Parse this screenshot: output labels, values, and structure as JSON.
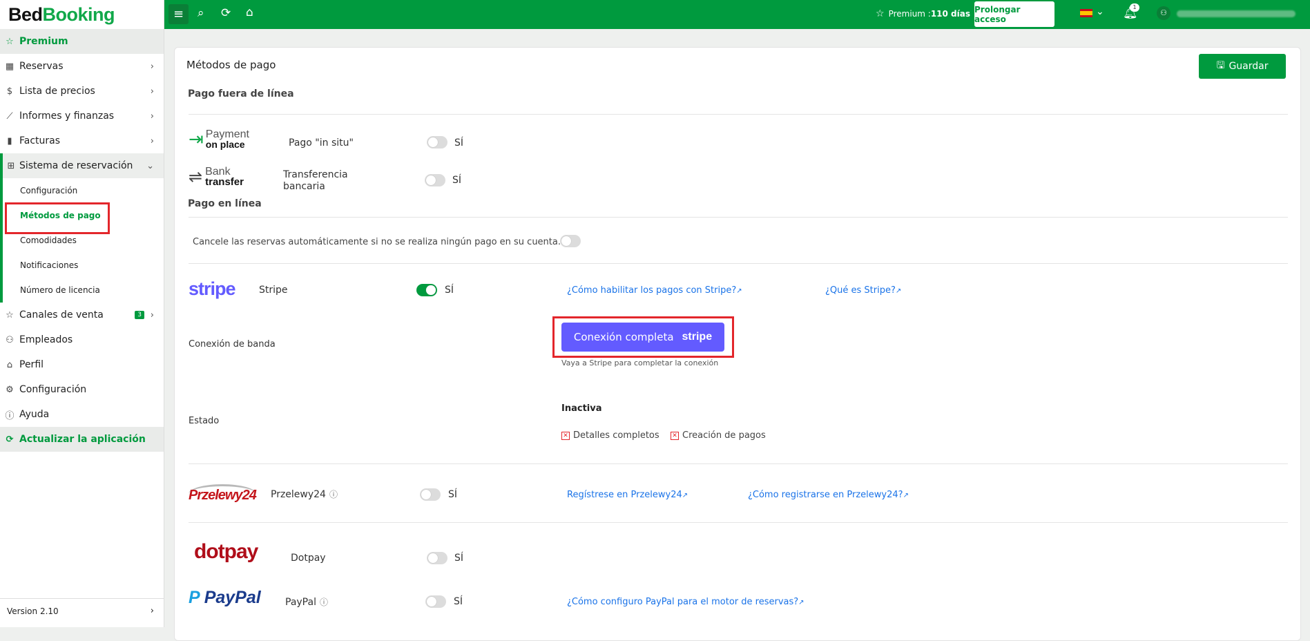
{
  "app": {
    "logo_part1": "Bed",
    "logo_part2": "Booking",
    "version": "Version 2.10"
  },
  "topbar": {
    "premium_label": "Premium : ",
    "premium_days": "110 días",
    "extend_button": "Prolongar acceso",
    "notification_count": "1",
    "language": "ES"
  },
  "sidebar": {
    "premium": "Premium",
    "items": [
      {
        "label": "Reservas",
        "icon": "calendar-icon"
      },
      {
        "label": "Lista de precios",
        "icon": "dollar-icon"
      },
      {
        "label": "Informes y finanzas",
        "icon": "chart-icon"
      },
      {
        "label": "Facturas",
        "icon": "invoice-icon"
      },
      {
        "label": "Sistema de reservación",
        "icon": "grid-icon"
      }
    ],
    "sub_items": [
      "Configuración",
      "Métodos de pago",
      "Comodidades",
      "Notificaciones",
      "Número de licencia"
    ],
    "items2": [
      {
        "label": "Canales de venta",
        "icon": "star-icon",
        "badge": "3"
      },
      {
        "label": "Empleados",
        "icon": "user-plus-icon"
      },
      {
        "label": "Perfil",
        "icon": "building-icon"
      },
      {
        "label": "Configuración",
        "icon": "gear-icon"
      },
      {
        "label": "Ayuda",
        "icon": "info-icon"
      }
    ],
    "update": "Actualizar la aplicación"
  },
  "page": {
    "title": "Métodos de pago",
    "save_button": "Guardar",
    "offline_section": "Pago fuera de línea",
    "online_section": "Pago en línea",
    "auto_cancel": "Cancele las reservas automáticamente si no se realiza ningún pago en su cuenta.",
    "yes": "SÍ",
    "methods": {
      "onsite": {
        "logo_line1": "Payment",
        "logo_line2": "on place",
        "name": "Pago \"in situ\"",
        "enabled": false
      },
      "bank": {
        "logo_line1": "Bank",
        "logo_line2": "transfer",
        "name_line1": "Transferencia",
        "name_line2": "bancaria",
        "enabled": false
      },
      "stripe": {
        "logo": "stripe",
        "name": "Stripe",
        "enabled": true,
        "link1": "¿Cómo habilitar los pagos con Stripe?",
        "link2": "¿Qué es Stripe?"
      },
      "przelewy": {
        "logo": "Przelewy24",
        "name": "Przelewy24",
        "enabled": false,
        "link1": "Regístrese en Przelewy24",
        "link2": "¿Cómo registrarse en Przelewy24?"
      },
      "dotpay": {
        "logo": "dotpay",
        "name": "Dotpay",
        "enabled": false
      },
      "paypal": {
        "logo": "PayPal",
        "name": "PayPal",
        "enabled": false,
        "link1": "¿Cómo configuro PayPal para el motor de reservas?"
      }
    },
    "stripe_connection": {
      "label": "Conexión de banda",
      "button": "Conexión completa",
      "button_logo": "stripe",
      "hint": "Vaya a Stripe para completar la conexión",
      "status_label": "Estado",
      "status": "Inactiva",
      "check1": "Detalles completos",
      "check2": "Creación de pagos"
    }
  },
  "colors": {
    "brand_green": "#009a3e",
    "stripe_purple": "#635bff",
    "highlight_red": "#e3262b",
    "link_blue": "#1a73e8"
  }
}
